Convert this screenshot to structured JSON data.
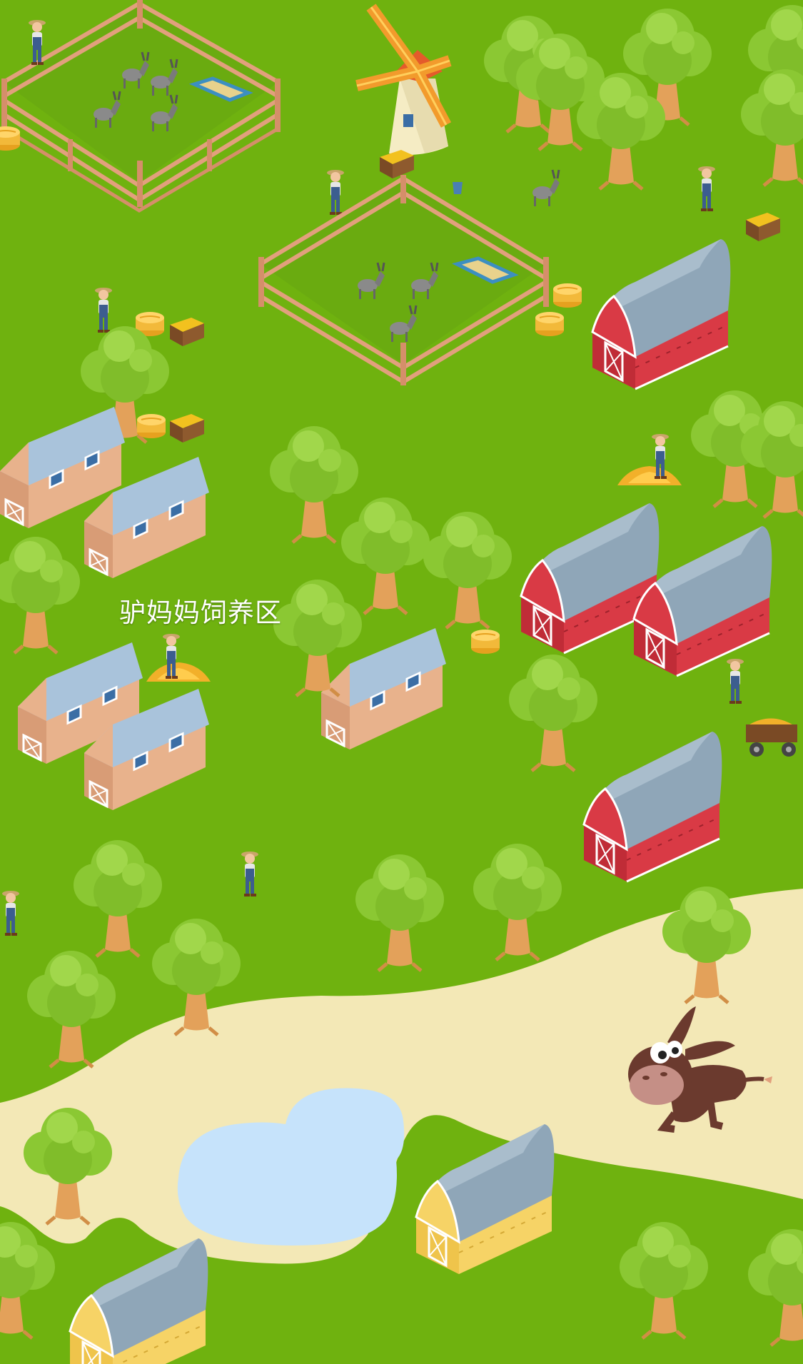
{
  "scene": {
    "area_label": "驴妈妈饲养区",
    "colors": {
      "grass": "#6fb20f",
      "path": "#f3e8b6",
      "pond": "#c6e3fb",
      "fence": "#e2a07d",
      "red_barn": "#d93a45",
      "yellow_barn": "#f6d366",
      "roof": "#8fa6b8",
      "house_wall": "#e8b28c",
      "tree_leaf": "#8bc833",
      "trunk": "#e3a15a"
    }
  }
}
